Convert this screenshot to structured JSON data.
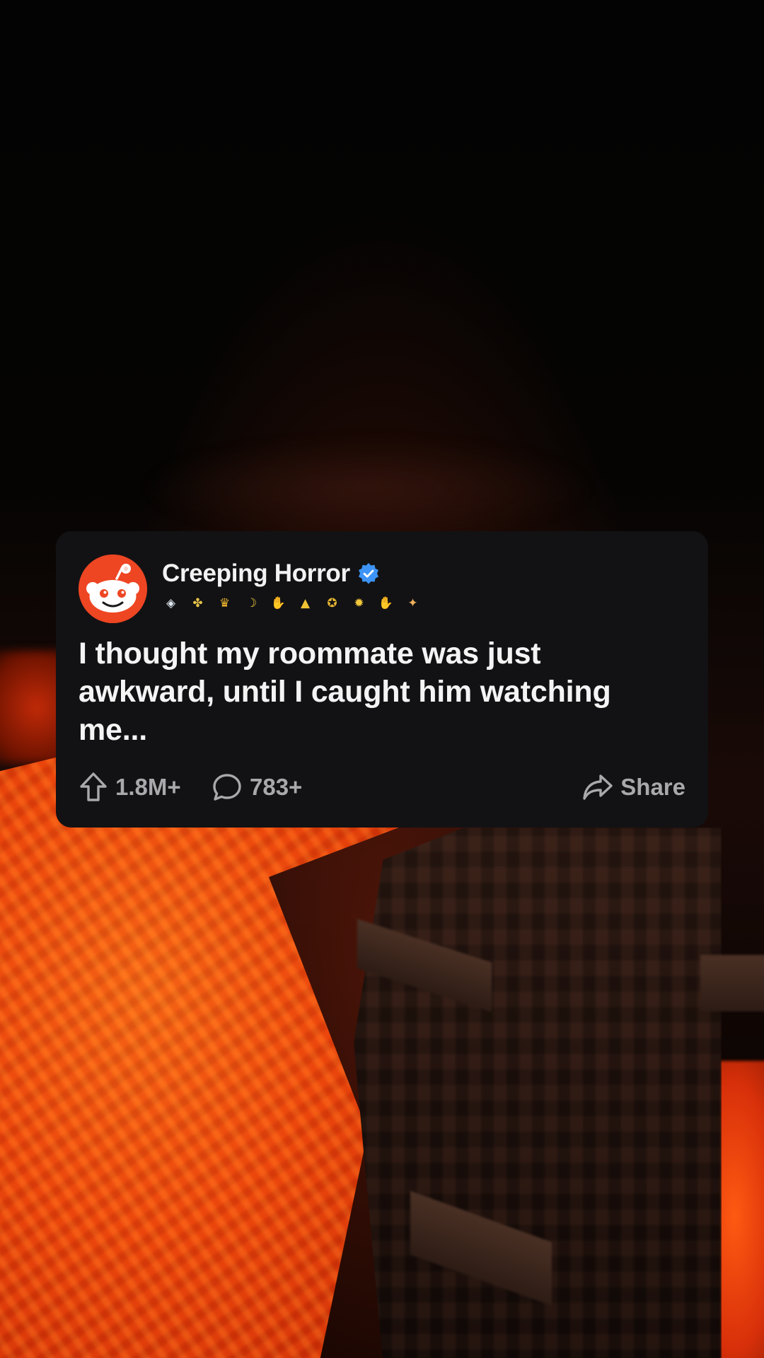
{
  "post": {
    "author": "Creeping Horror",
    "verified": true,
    "avatar_icon": "reddit-snoo-icon",
    "awards": [
      {
        "icon": "award-gem-icon",
        "color": "#dfe8f0",
        "glyph": "◈"
      },
      {
        "icon": "award-clover-icon",
        "color": "#e6c34a",
        "glyph": "✤"
      },
      {
        "icon": "award-trophy-icon",
        "color": "#f0b730",
        "glyph": "♛"
      },
      {
        "icon": "award-banana-icon",
        "color": "#f2cf3d",
        "glyph": "☽"
      },
      {
        "icon": "award-hands-icon",
        "color": "#d9d9d9",
        "glyph": "✋"
      },
      {
        "icon": "award-helmet-icon",
        "color": "#f0c333",
        "glyph": "▲"
      },
      {
        "icon": "award-gold-icon",
        "color": "#e8b732",
        "glyph": "✪"
      },
      {
        "icon": "award-burst-icon",
        "color": "#f3c93c",
        "glyph": "✹"
      },
      {
        "icon": "award-wave-icon",
        "color": "#e6e6e6",
        "glyph": "✋"
      },
      {
        "icon": "award-rocket-icon",
        "color": "#f0b05a",
        "glyph": "✦"
      }
    ],
    "title": "I thought my roommate was just awkward, until I caught him watching me...",
    "upvotes": "1.8M+",
    "comments": "783+",
    "share_label": "Share"
  },
  "colors": {
    "card_bg": "#121214",
    "reddit_orange": "#ee4523",
    "verified_blue": "#3d94f6",
    "action_gray": "#a9a9ad"
  }
}
